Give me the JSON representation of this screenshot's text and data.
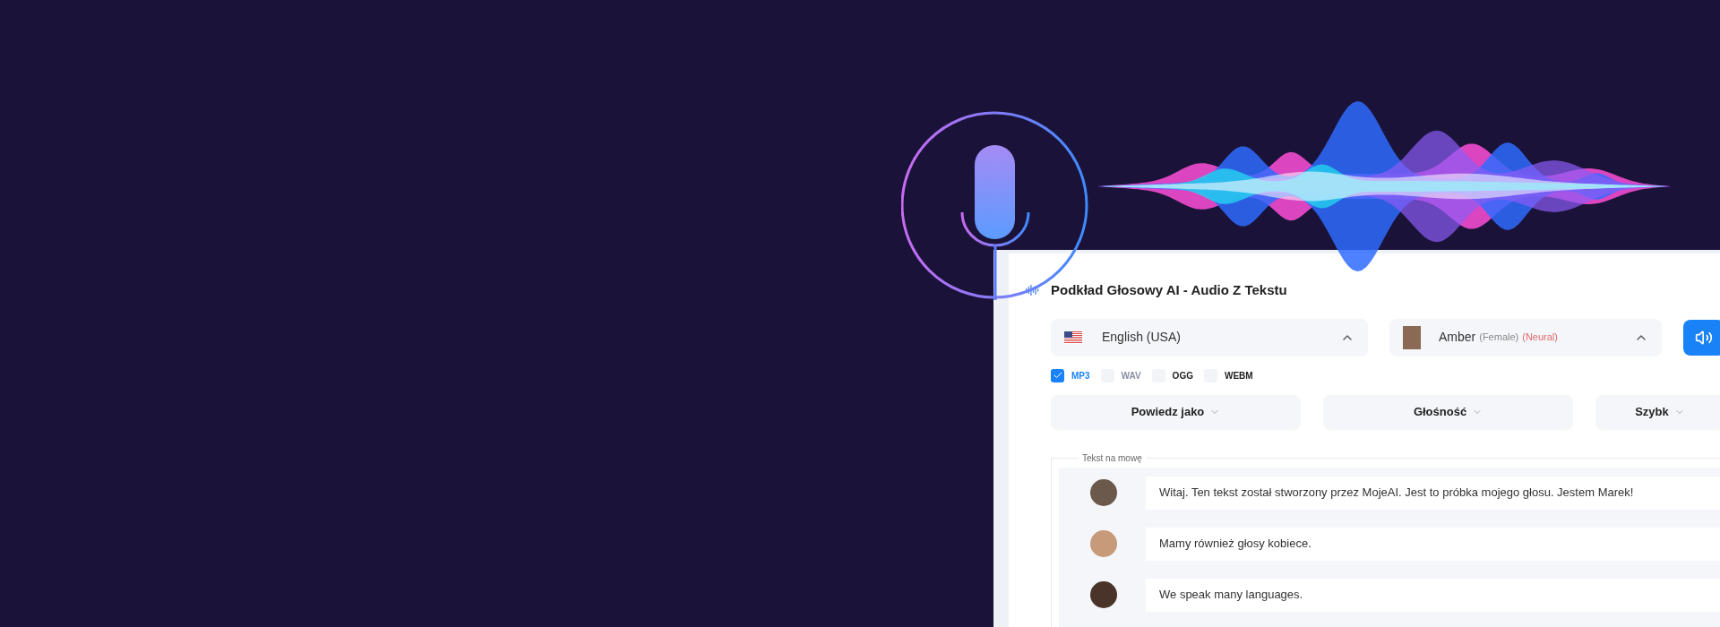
{
  "panel": {
    "title": "Podkład Głosowy AI - Audio Z Tekstu"
  },
  "language": {
    "label": "English (USA)",
    "expanded": true
  },
  "voice": {
    "name": "Amber",
    "gender": "(Female)",
    "type": "(Neural)",
    "expanded": true
  },
  "formats": [
    {
      "label": "MP3",
      "checked": true,
      "disabled": false
    },
    {
      "label": "WAV",
      "checked": false,
      "disabled": true
    },
    {
      "label": "OGG",
      "checked": false,
      "disabled": false
    },
    {
      "label": "WEBM",
      "checked": false,
      "disabled": false
    }
  ],
  "options": [
    {
      "label": "Powiedz jako"
    },
    {
      "label": "Głośność"
    },
    {
      "label": "Szybk"
    }
  ],
  "text_box": {
    "legend": "Tekst na mowę",
    "lines": [
      {
        "text": "Witaj. Ten tekst został stworzony przez MojeAI.  Jest to próbka mojego głosu. Jestem Marek!"
      },
      {
        "text": "Mamy również głosy kobiece."
      },
      {
        "text": "We speak many languages."
      }
    ]
  }
}
